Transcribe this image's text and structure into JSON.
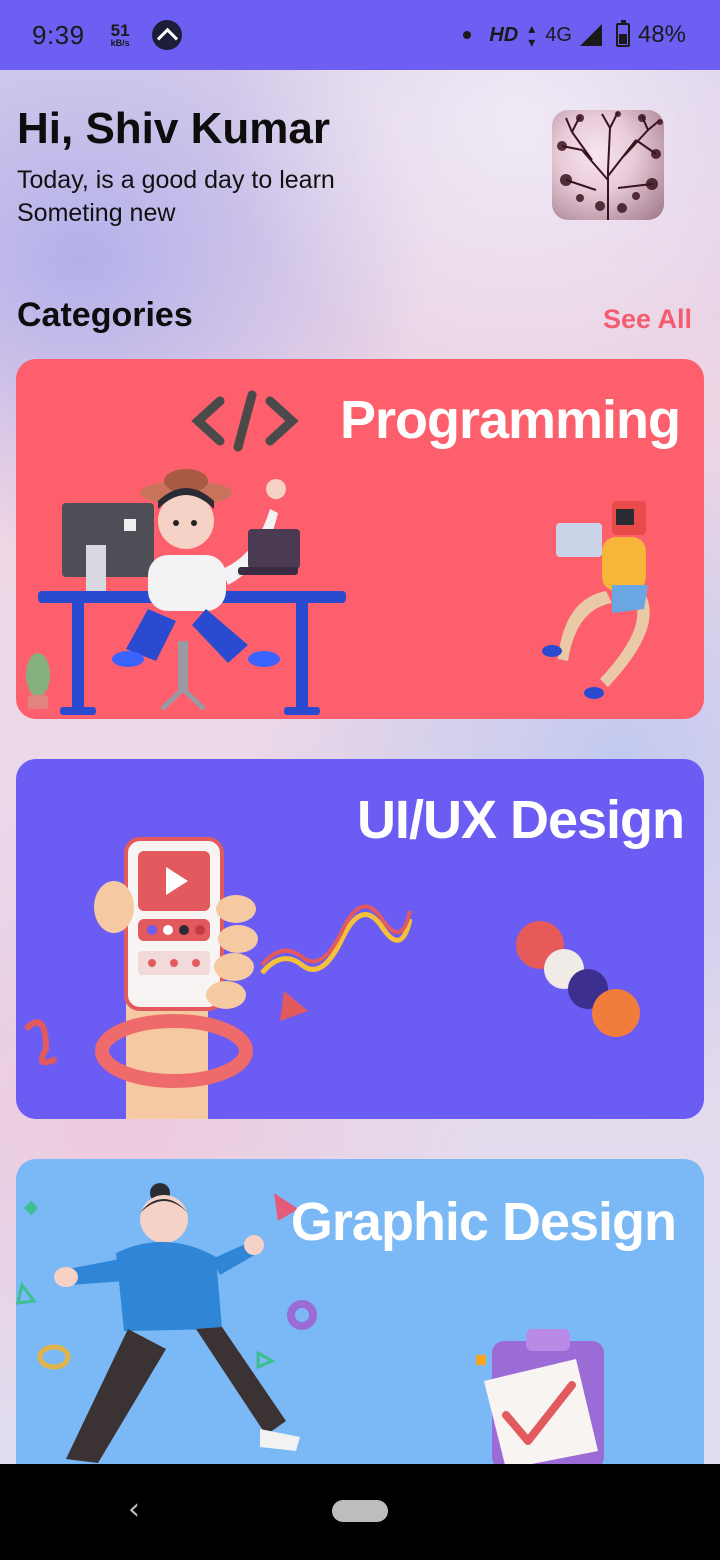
{
  "status_bar": {
    "time": "9:39",
    "speed_value": "51",
    "speed_unit": "kB/s",
    "network_hd": "HD",
    "network_type": "4G",
    "battery": "48%"
  },
  "header": {
    "greeting": "Hi, Shiv Kumar",
    "subtitle": "Today, is a good day to learn Someting new"
  },
  "categories": {
    "title": "Categories",
    "see_all": "See All",
    "items": [
      {
        "label": "Programming",
        "color": "#fd5f6d"
      },
      {
        "label": "UI/UX Design",
        "color": "#6b5cf3"
      },
      {
        "label": "Graphic Design",
        "color": "#7ab9f6"
      }
    ]
  },
  "nav": {
    "back_glyph": "‹"
  }
}
